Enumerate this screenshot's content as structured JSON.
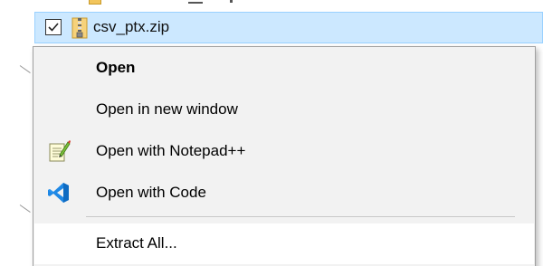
{
  "file_list": {
    "selected_file": {
      "name": "csv_ptx.zip",
      "checked": true,
      "icon": "zip-folder-icon"
    }
  },
  "context_menu": {
    "items": [
      {
        "label": "Open",
        "bold": true,
        "icon": ""
      },
      {
        "label": "Open in new window",
        "bold": false,
        "icon": ""
      },
      {
        "label": "Open with Notepad++",
        "bold": false,
        "icon": "notepad-plus-plus-icon"
      },
      {
        "label": "Open with Code",
        "bold": false,
        "icon": "vscode-icon"
      },
      {
        "label": "Extract All...",
        "bold": false,
        "icon": ""
      }
    ]
  },
  "colors": {
    "selection_bg": "#cce8ff",
    "selection_border": "#99d1ff",
    "menu_bg": "#f2f2f2",
    "menu_hover_bg": "#ffffff",
    "vscode_blue": "#1f88e5"
  }
}
